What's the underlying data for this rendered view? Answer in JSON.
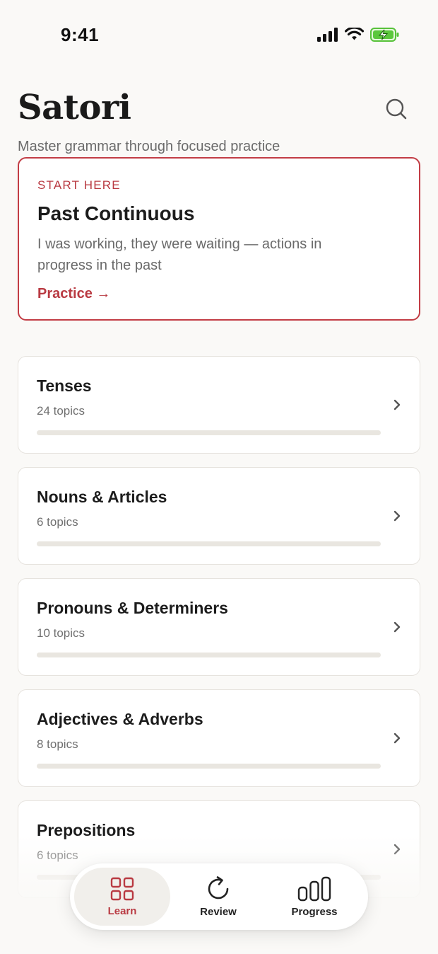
{
  "status_bar": {
    "time": "9:41"
  },
  "header": {
    "title": "Satori",
    "subtitle": "Master grammar through focused practice",
    "search_icon": "search-icon"
  },
  "hero": {
    "eyebrow": "START HERE",
    "title": "Past Continuous",
    "description": "I was working, they were waiting — actions in progress in the past",
    "cta_label": "Practice →",
    "accent_color": "#b93a42"
  },
  "categories": [
    {
      "title": "Tenses",
      "count": "24 topics",
      "progress": 0
    },
    {
      "title": "Nouns & Articles",
      "count": "6 topics",
      "progress": 0
    },
    {
      "title": "Pronouns & Determiners",
      "count": "10 topics",
      "progress": 0
    },
    {
      "title": "Adjectives & Adverbs",
      "count": "8 topics",
      "progress": 0
    },
    {
      "title": "Prepositions",
      "count": "6 topics",
      "progress": 0
    }
  ],
  "tabs": [
    {
      "label": "Learn",
      "icon": "grid-icon",
      "active": true
    },
    {
      "label": "Review",
      "icon": "refresh-icon",
      "active": false
    },
    {
      "label": "Progress",
      "icon": "bar-chart-icon",
      "active": false
    }
  ]
}
